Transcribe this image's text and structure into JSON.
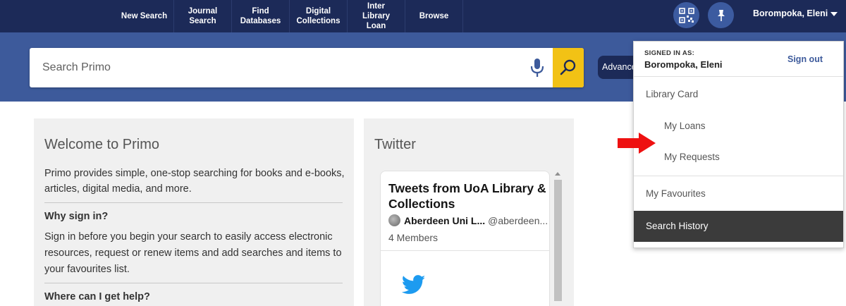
{
  "nav": {
    "new_search": [
      "New Search"
    ],
    "journal_search": [
      "Journal",
      "Search"
    ],
    "find_databases": [
      "Find",
      "Databases"
    ],
    "digital_collections": [
      "Digital",
      "Collections"
    ],
    "inter_library_loan": [
      "Inter",
      "Library",
      "Loan"
    ],
    "browse": [
      "Browse"
    ],
    "user_name": "Borompoka, Eleni",
    "icons": [
      "qr-code-icon",
      "pin-icon",
      "chevron-down-icon"
    ]
  },
  "search": {
    "placeholder": "Search Primo",
    "advanced_label": "Advanced Search",
    "icons": [
      "microphone-icon",
      "search-icon"
    ]
  },
  "welcome": {
    "title": "Welcome to Primo",
    "intro": "Primo provides simple, one-stop searching for books and e-books, articles, digital media, and more.",
    "why_title": "Why sign in?",
    "why_text": "Sign in before you begin your search to easily access electronic resources, request or renew items and add searches and items to your favourites list.",
    "help_title": "Where can I get help?"
  },
  "twitter": {
    "title": "Twitter",
    "heading": "Tweets from UoA Library & Collections",
    "account_name": "Aberdeen Uni L...",
    "handle": "@aberdeen...",
    "members": "4 Members"
  },
  "user_menu": {
    "signed_in_label": "SIGNED IN AS:",
    "signed_in_name": "Borompoka, Eleni",
    "sign_out": "Sign out",
    "items": [
      {
        "label": "Library Card",
        "indent": false,
        "active": false
      },
      {
        "label": "My Loans",
        "indent": true,
        "active": false
      },
      {
        "label": "My Requests",
        "indent": true,
        "active": false
      },
      {
        "label": "My Favourites",
        "indent": false,
        "active": false
      },
      {
        "label": "Search History",
        "indent": false,
        "active": true
      }
    ]
  },
  "colors": {
    "nav_bg": "#1c2a58",
    "search_band_bg": "#3d5a9b",
    "search_button": "#f2c215",
    "panel_bg": "#f0f0f0",
    "menu_active_bg": "#3b3b3b",
    "annotation_arrow": "#ee1111",
    "twitter_blue": "#1d9bf0"
  }
}
